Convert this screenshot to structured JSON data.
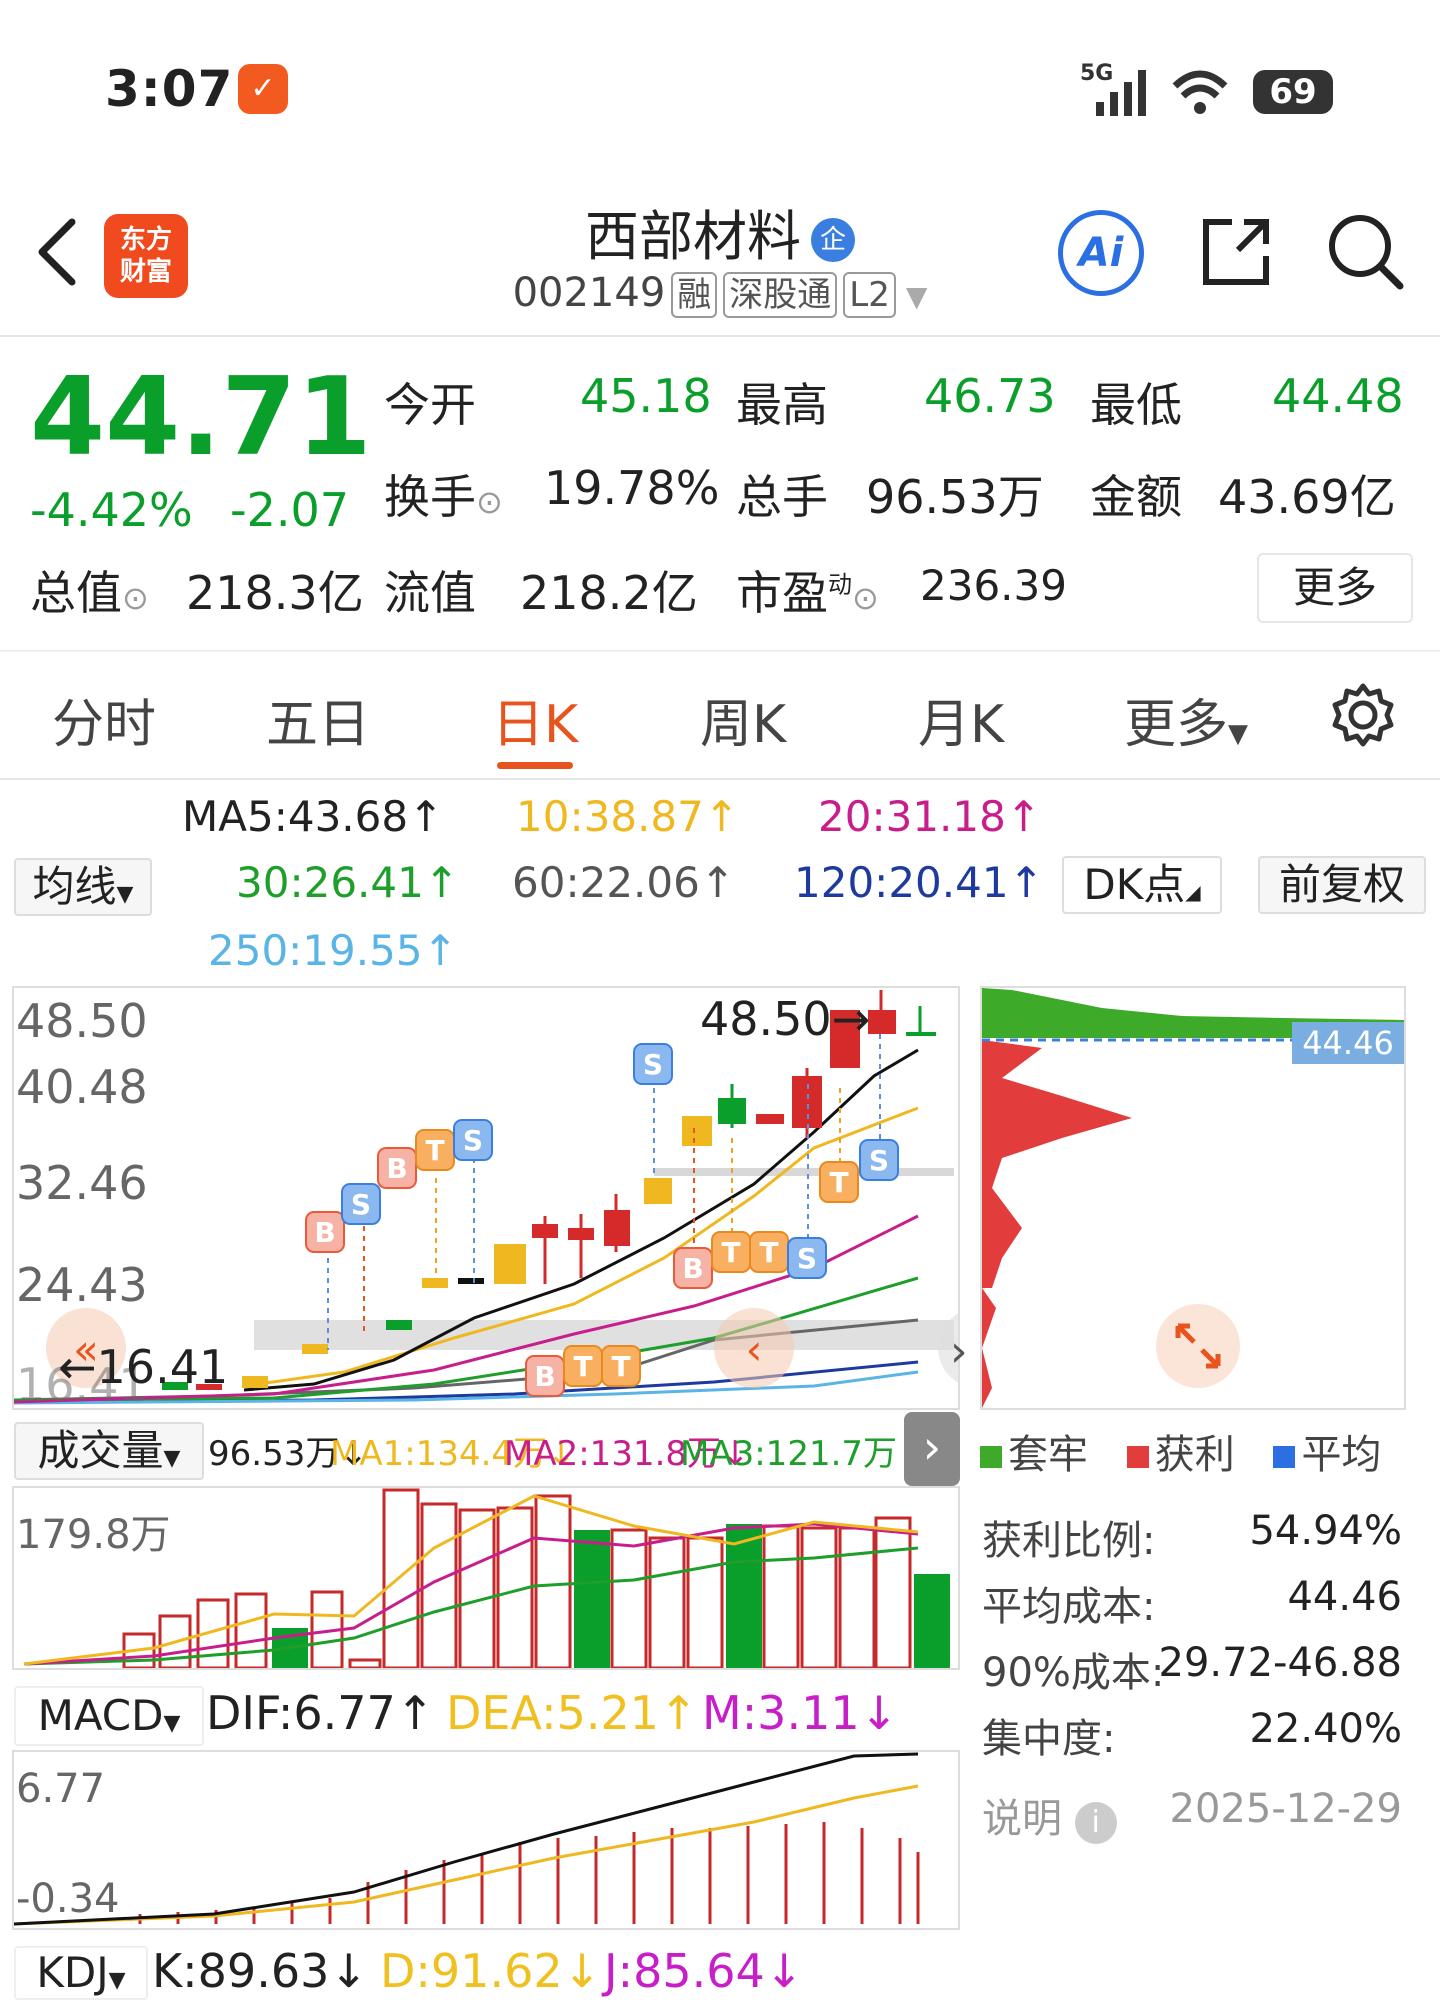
{
  "status": {
    "time": "3:07",
    "network": "5G",
    "battery": "69"
  },
  "header": {
    "logo_line1": "东方",
    "logo_line2": "财富",
    "stock_name": "西部材料",
    "badge": "企",
    "code": "002149",
    "tags": [
      "融",
      "深股通",
      "L2"
    ],
    "ai": "Ai"
  },
  "quote": {
    "price": "44.71",
    "change_pct": "-4.42%",
    "change": "-2.07",
    "open_label": "今开",
    "open": "45.18",
    "high_label": "最高",
    "high": "46.73",
    "low_label": "最低",
    "low": "44.48",
    "turnover_label": "换手",
    "turnover": "19.78%",
    "volume_label": "总手",
    "volume": "96.53万",
    "amount_label": "金额",
    "amount": "43.69亿",
    "mktcap_label": "总值",
    "mktcap": "218.3亿",
    "float_label": "流值",
    "float": "218.2亿",
    "pe_label": "市盈",
    "pe_sup": "动",
    "pe": "236.39",
    "more": "更多"
  },
  "tabs": {
    "items": [
      "分时",
      "五日",
      "日K",
      "周K",
      "月K",
      "更多"
    ],
    "active": "日K"
  },
  "ma": {
    "selector": "均线",
    "ma5": "MA5:43.68↑",
    "ma10": "10:38.87↑",
    "ma20": "20:31.18↑",
    "ma30": "30:26.41↑",
    "ma60": "60:22.06↑",
    "ma120": "120:20.41↑",
    "ma250": "250:19.55↑",
    "dk": "DK点",
    "adj": "前复权"
  },
  "kline": {
    "y_labels": [
      "48.50",
      "40.48",
      "32.46",
      "24.43",
      "16.41"
    ],
    "high_marker": "48.50→",
    "low_marker": "←16.41",
    "signals": [
      "B",
      "S",
      "B",
      "T",
      "S",
      "S",
      "B",
      "T",
      "T",
      "S",
      "T",
      "S",
      "B",
      "T",
      "T"
    ]
  },
  "chip": {
    "price_line": "44.46",
    "legend": [
      "套牢",
      "获利",
      "平均"
    ]
  },
  "chip_stats": [
    {
      "label": "获利比例:",
      "value": "54.94%"
    },
    {
      "label": "平均成本:",
      "value": "44.46"
    },
    {
      "label": "90%成本:",
      "value": "29.72-46.88"
    },
    {
      "label": "集中度:",
      "value": "22.40%"
    }
  ],
  "chip_note": {
    "label": "说明",
    "date": "2025-12-29"
  },
  "volume": {
    "selector": "成交量",
    "vol": "96.53万↓",
    "ma1": "MA1:134.4万↓",
    "ma2": "MA2:131.8万↓",
    "ma3": "MA3:121.7万↑",
    "y_label": "179.8万"
  },
  "macd": {
    "selector": "MACD",
    "dif": "DIF:6.77↑",
    "dea": "DEA:5.21↑",
    "m": "M:3.11↓",
    "y_top": "6.77",
    "y_bottom": "-0.34"
  },
  "kdj": {
    "selector": "KDJ",
    "k": "K:89.63↓",
    "d": "D:91.62↓",
    "j": "J:85.64↓"
  },
  "colors": {
    "up": "#d42a2a",
    "down": "#0a9e2a",
    "accent": "#e8541e",
    "ma5": "#222222",
    "ma10": "#f0b820",
    "ma20": "#c81e8c",
    "ma30": "#1e9e2a",
    "ma60": "#666666",
    "ma120": "#1e3a9e",
    "ma250": "#5ab4e6"
  }
}
